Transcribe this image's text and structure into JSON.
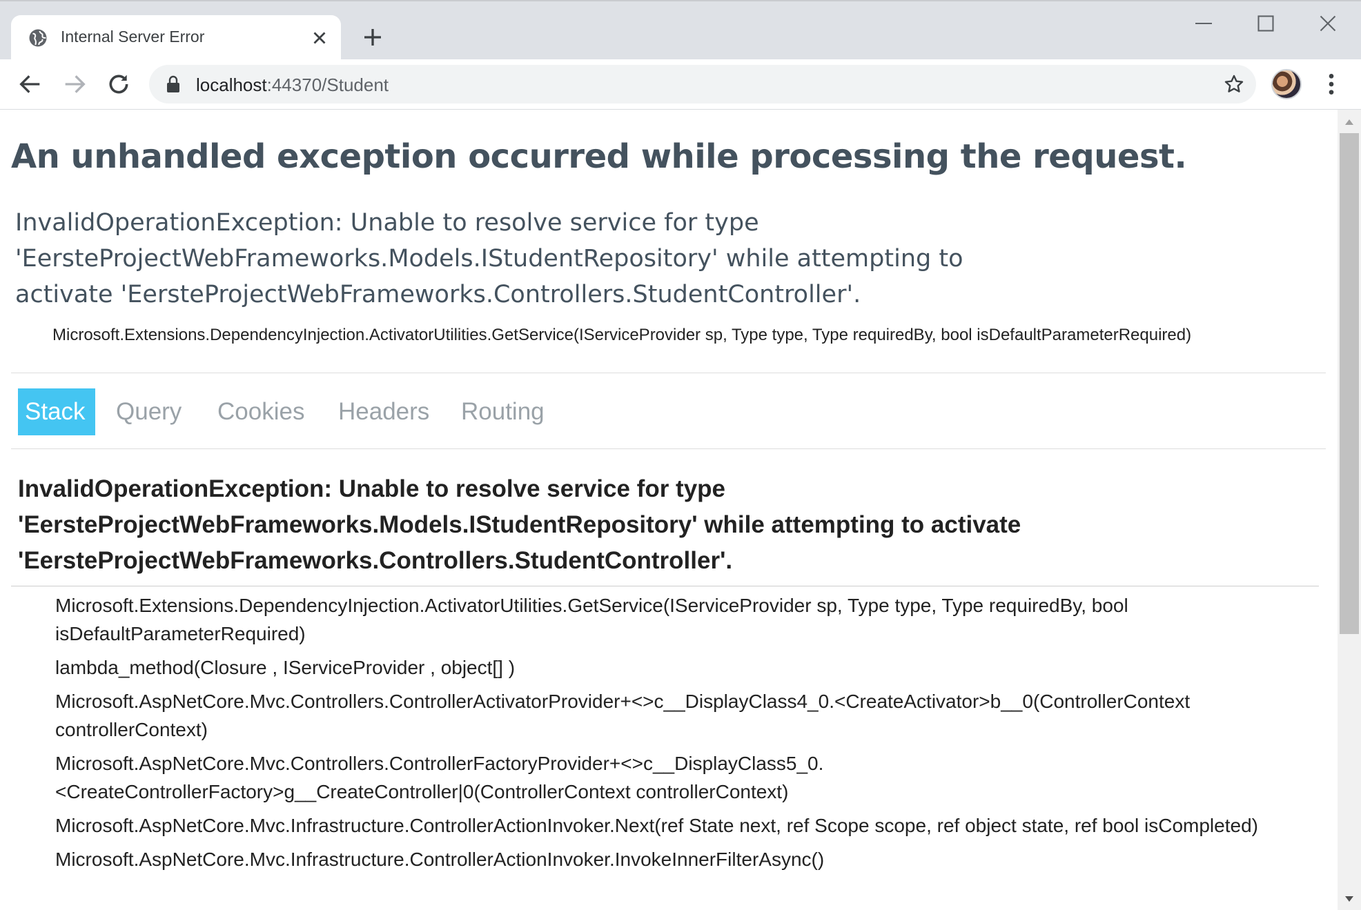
{
  "browser": {
    "tab_title": "Internal Server Error",
    "url_host": "localhost",
    "url_rest": ":44370/Student",
    "icons": [
      "globe-icon",
      "close-icon",
      "plus-icon",
      "minimize-icon",
      "maximize-icon",
      "window-close-icon",
      "back-arrow-icon",
      "forward-arrow-icon",
      "reload-icon",
      "lock-icon",
      "star-icon",
      "kebab-menu-icon"
    ]
  },
  "page": {
    "heading": "An unhandled exception occurred while processing the request.",
    "error_title": "InvalidOperationException: Unable to resolve service for type 'EersteProjectWebFrameworks.Models.IStudentRepository' while attempting to activate 'EersteProjectWebFrameworks.Controllers.StudentController'.",
    "error_location": "Microsoft.Extensions.DependencyInjection.ActivatorUtilities.GetService(IServiceProvider sp, Type type, Type requiredBy, bool isDefaultParameterRequired)",
    "tabs": [
      {
        "label": "Stack",
        "selected": true
      },
      {
        "label": "Query",
        "selected": false
      },
      {
        "label": "Cookies",
        "selected": false
      },
      {
        "label": "Headers",
        "selected": false
      },
      {
        "label": "Routing",
        "selected": false
      }
    ],
    "stack": {
      "title": "InvalidOperationException: Unable to resolve service for type 'EersteProjectWebFrameworks.Models.IStudentRepository' while attempting to activate 'EersteProjectWebFrameworks.Controllers.StudentController'.",
      "frames": [
        "Microsoft.Extensions.DependencyInjection.ActivatorUtilities.GetService(IServiceProvider sp, Type type, Type requiredBy, bool isDefaultParameterRequired)",
        "lambda_method(Closure , IServiceProvider , object[] )",
        "Microsoft.AspNetCore.Mvc.Controllers.ControllerActivatorProvider+<>c__DisplayClass4_0.<CreateActivator>b__0(ControllerContext controllerContext)",
        "Microsoft.AspNetCore.Mvc.Controllers.ControllerFactoryProvider+<>c__DisplayClass5_0.<CreateControllerFactory>g__CreateController|0(ControllerContext controllerContext)",
        "Microsoft.AspNetCore.Mvc.Infrastructure.ControllerActionInvoker.Next(ref State next, ref Scope scope, ref object state, ref bool isCompleted)",
        "Microsoft.AspNetCore.Mvc.Infrastructure.ControllerActionInvoker.InvokeInnerFilterAsync()"
      ]
    }
  },
  "colors": {
    "selected_tab": "#44c5f2",
    "heading": "#44525e",
    "inactive_tab": "#9aa2a8"
  }
}
